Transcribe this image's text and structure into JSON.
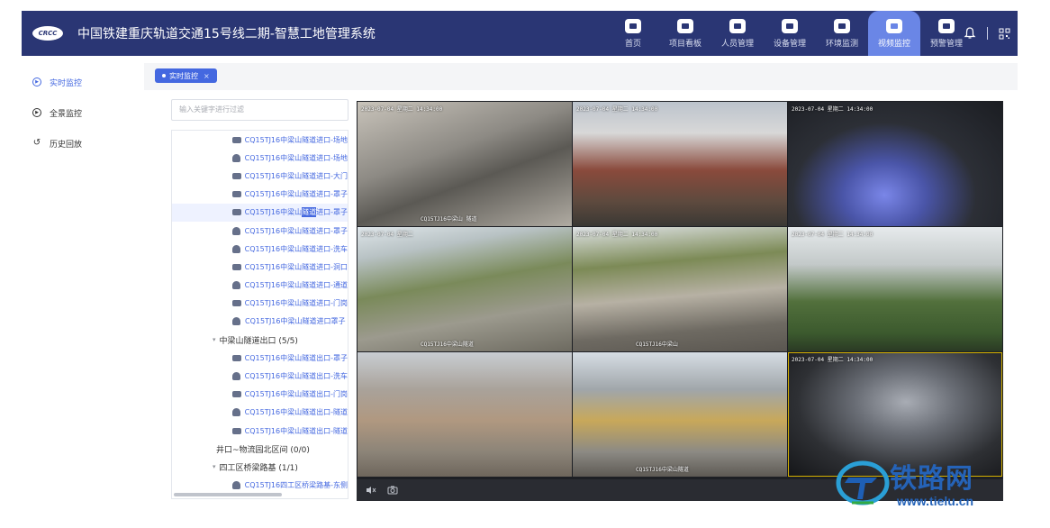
{
  "app": {
    "title": "中国铁建重庆轨道交通15号线二期-智慧工地管理系统",
    "logo_text": "CRCC"
  },
  "nav": [
    {
      "label": "首页",
      "icon": "home-icon"
    },
    {
      "label": "项目看板",
      "icon": "monitor-icon"
    },
    {
      "label": "人员管理",
      "icon": "user-icon"
    },
    {
      "label": "设备管理",
      "icon": "device-icon"
    },
    {
      "label": "环境监测",
      "icon": "environment-icon"
    },
    {
      "label": "视频监控",
      "icon": "video-icon",
      "active": true
    },
    {
      "label": "预警管理",
      "icon": "warning-icon"
    }
  ],
  "header_right": {
    "bell_icon": "bell-icon",
    "qr_icon": "qrcode-icon"
  },
  "side_menu": [
    {
      "label": "实时监控",
      "active": true
    },
    {
      "label": "全景监控"
    },
    {
      "label": "历史回放"
    }
  ],
  "tab": {
    "label": "实时监控",
    "close": "×"
  },
  "search": {
    "placeholder": "输入关键字进行过滤"
  },
  "tree": [
    {
      "type": "cam",
      "label": "CQ15TJ16中梁山隧道进口-场地"
    },
    {
      "type": "dome",
      "label": "CQ15TJ16中梁山隧道进口-场地"
    },
    {
      "type": "cam",
      "label": "CQ15TJ16中梁山隧道进口-大门"
    },
    {
      "type": "cam",
      "label": "CQ15TJ16中梁山隧道进口-罩子"
    },
    {
      "type": "cam",
      "label_pre": "CQ15TJ16中梁山",
      "label_hl": "隧道",
      "label_post": "进口-罩子",
      "selected": true
    },
    {
      "type": "dome",
      "label": "CQ15TJ16中梁山隧道进口-罩子"
    },
    {
      "type": "dome",
      "label": "CQ15TJ16中梁山隧道进口-洗车"
    },
    {
      "type": "cam",
      "label": "CQ15TJ16中梁山隧道进口-洞口"
    },
    {
      "type": "dome",
      "label": "CQ15TJ16中梁山隧道进口-通道"
    },
    {
      "type": "cam",
      "label": "CQ15TJ16中梁山隧道进口-门岗"
    },
    {
      "type": "dome",
      "label": "CQ15TJ16中梁山隧道进口罩子"
    },
    {
      "type": "group",
      "caret": "▾",
      "label": "中梁山隧道出口 (5/5)"
    },
    {
      "type": "cam",
      "label": "CQ15TJ16中梁山隧道出口-罩子"
    },
    {
      "type": "dome",
      "label": "CQ15TJ16中梁山隧道出口-洗车"
    },
    {
      "type": "cam",
      "label": "CQ15TJ16中梁山隧道出口-门岗"
    },
    {
      "type": "dome",
      "label": "CQ15TJ16中梁山隧道出口-隧道"
    },
    {
      "type": "cam",
      "label": "CQ15TJ16中梁山隧道出口-隧道"
    },
    {
      "type": "group",
      "caret": "",
      "label": "井口~物流园北区间 (0/0)"
    },
    {
      "type": "group",
      "caret": "▾",
      "label": "四工区桥梁路基 (1/1)"
    },
    {
      "type": "dome",
      "label": "CQ15TJ16四工区桥梁路基-东侧"
    }
  ],
  "videos": [
    {
      "osd": "2023-07-04 星期二 14:34:00",
      "osd_bottom": "CQ15TJ16中梁山 隧道"
    },
    {
      "osd": "2023-07-04 星期二 14:34:00",
      "osd_bottom": ""
    },
    {
      "osd": "2023-07-04 星期二 14:34:00",
      "osd_bottom": ""
    },
    {
      "osd": "2023-07-04 星期二",
      "osd_bottom": "CQ15TJ16中梁山隧道"
    },
    {
      "osd": "2023-07-04 星期二 14:34:00",
      "osd_bottom": "CQ15TJ16中梁山"
    },
    {
      "osd": "2023-07-04 星期二 14:34:00",
      "osd_bottom": ""
    },
    {
      "osd": "",
      "osd_bottom": ""
    },
    {
      "osd": "",
      "osd_bottom": "CQ15TJ16中梁山隧道"
    },
    {
      "osd": "2023-07-04 星期二 14:34:00",
      "osd_bottom": ""
    }
  ],
  "player": {
    "mute_icon": "volume-mute-icon",
    "snapshot_icon": "camera-icon"
  },
  "watermark": {
    "text": "铁路网",
    "url": "www.tielu.cn"
  },
  "colors": {
    "header": "#2a3674",
    "accent": "#4468e0",
    "nav_active": "#6a86e6"
  }
}
